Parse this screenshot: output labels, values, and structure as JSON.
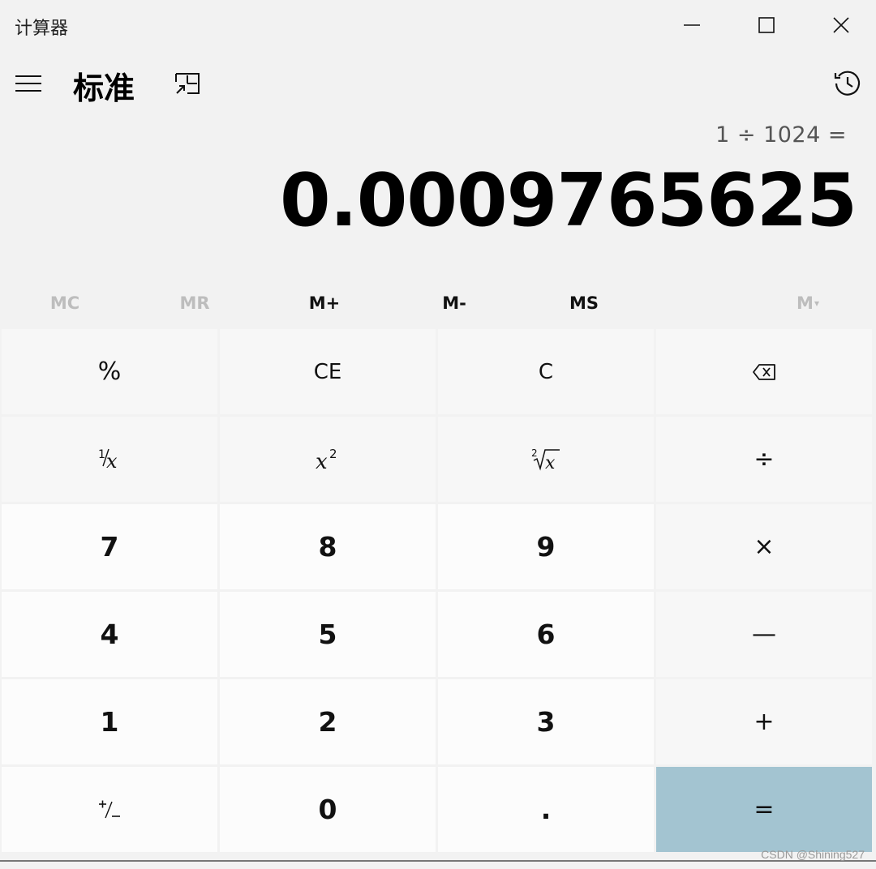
{
  "window": {
    "title": "计算器"
  },
  "header": {
    "mode": "标准"
  },
  "display": {
    "expression": "1 ÷ 1024 =",
    "result": "0.0009765625"
  },
  "memory": {
    "mc": "MC",
    "mr": "MR",
    "mplus": "M+",
    "mminus": "M-",
    "ms": "MS",
    "mlist": "M"
  },
  "keys": {
    "percent": "%",
    "ce": "CE",
    "c": "C",
    "divide": "÷",
    "multiply": "×",
    "minus": "—",
    "plus": "+",
    "equals": "=",
    "d7": "7",
    "d8": "8",
    "d9": "9",
    "d4": "4",
    "d5": "5",
    "d6": "6",
    "d1": "1",
    "d2": "2",
    "d3": "3",
    "d0": "0",
    "decimal": "."
  },
  "colors": {
    "equals_bg": "#a3c4d1",
    "background": "#f2f2f2"
  },
  "watermark": "CSDN @Shining527"
}
